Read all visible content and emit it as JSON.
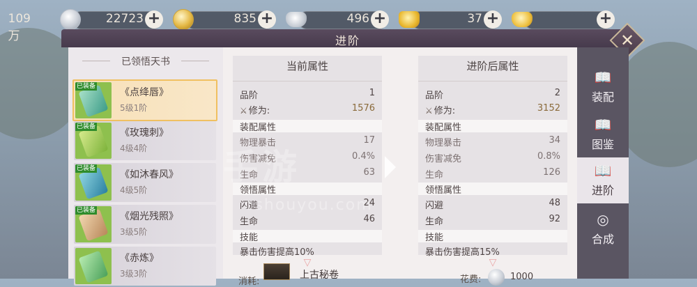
{
  "currencies": [
    {
      "icon": "silver-coin-icon",
      "value": "109万"
    },
    {
      "icon": "gold-coin-icon",
      "value": "22723"
    },
    {
      "icon": "silver-ingot-icon",
      "value": "835"
    },
    {
      "icon": "gold-ingot-icon",
      "value": "496"
    },
    {
      "icon": "gold-ingot-icon",
      "value": "37"
    }
  ],
  "window": {
    "title": "进阶",
    "close_glyph": "✕"
  },
  "left": {
    "header": "已领悟天书",
    "books": [
      {
        "name": "《点绛唇》",
        "level": "5级1阶",
        "tag": "已装备",
        "selected": true
      },
      {
        "name": "《玫瑰刺》",
        "level": "4级4阶",
        "tag": "已装备"
      },
      {
        "name": "《如沐春风》",
        "level": "4级5阶",
        "tag": "已装备"
      },
      {
        "name": "《烟光残照》",
        "level": "3级5阶",
        "tag": "已装备"
      },
      {
        "name": "《赤炼》",
        "level": "3级3阶",
        "tag": ""
      }
    ]
  },
  "current": {
    "title": "当前属性",
    "rank_label": "品阶",
    "rank": "1",
    "cultivation_label": "修为:",
    "cultivation": "1576",
    "equip_section": "装配属性",
    "equip": [
      {
        "k": "物理暴击",
        "v": "17"
      },
      {
        "k": "伤害减免",
        "v": "0.4%"
      },
      {
        "k": "生命",
        "v": "63"
      }
    ],
    "insight_section": "领悟属性",
    "insight": [
      {
        "k": "闪避",
        "v": "24"
      },
      {
        "k": "生命",
        "v": "46"
      }
    ],
    "skill_section": "技能",
    "skill_text": "暴击伤害提高10%"
  },
  "after": {
    "title": "进阶后属性",
    "rank_label": "品阶",
    "rank": "2",
    "cultivation_label": "修为:",
    "cultivation": "3152",
    "equip_section": "装配属性",
    "equip": [
      {
        "k": "物理暴击",
        "v": "34"
      },
      {
        "k": "伤害减免",
        "v": "0.8%"
      },
      {
        "k": "生命",
        "v": "126"
      }
    ],
    "insight_section": "领悟属性",
    "insight": [
      {
        "k": "闪避",
        "v": "48"
      },
      {
        "k": "生命",
        "v": "92"
      }
    ],
    "skill_section": "技能",
    "skill_text": "暴击伤害提高15%"
  },
  "cost": {
    "label": "消耗:",
    "item_name": "上古秘卷",
    "fee_label": "花费:",
    "fee_value": "1000"
  },
  "tabs": [
    {
      "label": "装配",
      "icon": "book-icon"
    },
    {
      "label": "图鉴",
      "icon": "book-icon"
    },
    {
      "label": "进阶",
      "icon": "book-icon",
      "selected": true
    },
    {
      "label": "合成",
      "icon": "swirl-icon"
    }
  ],
  "watermark": {
    "line1": "手游",
    "line2": "oshouyou.com"
  }
}
